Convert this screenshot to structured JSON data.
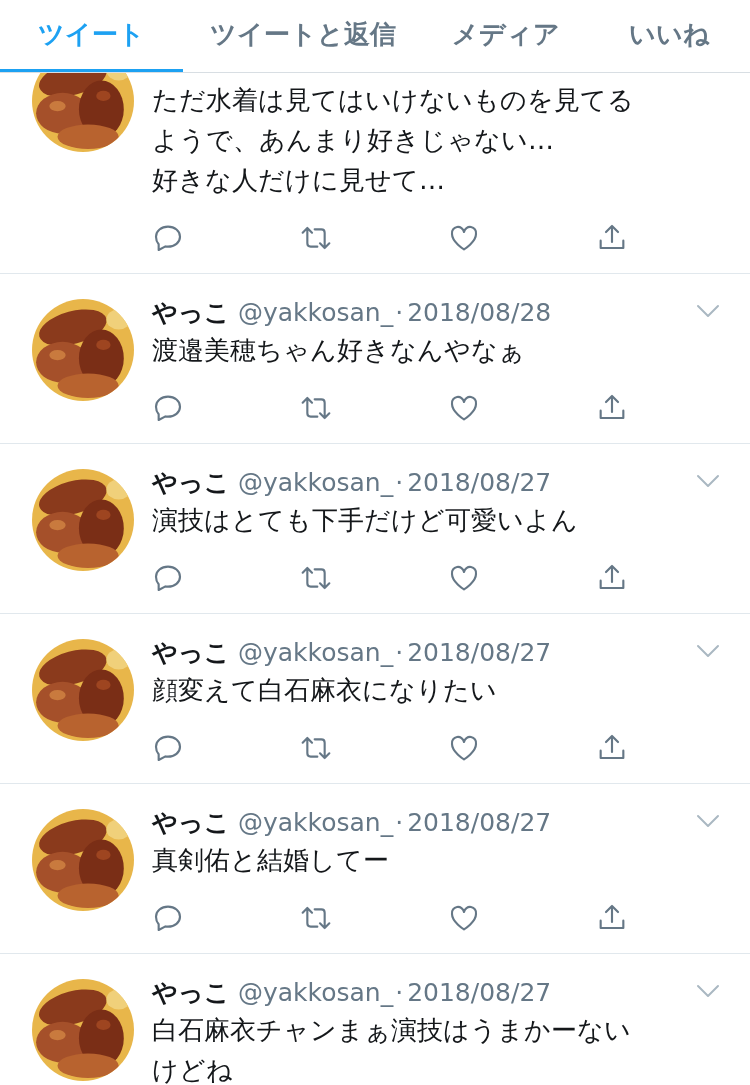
{
  "tabs": [
    {
      "label": "ツイート",
      "selected": true
    },
    {
      "label": "ツイートと返信",
      "selected": false
    },
    {
      "label": "メディア",
      "selected": false
    },
    {
      "label": "いいね",
      "selected": false
    }
  ],
  "tweets": [
    {
      "kind": "partial",
      "text": "ただ水着は見てはいけないものを見てるようで、あんまり好きじゃない…\n好きな人だけに見せて…"
    },
    {
      "kind": "full",
      "name": "やっこ",
      "handle": "@yakkosan_",
      "dot": "·",
      "date": "2018/08/28",
      "text": "渡邉美穂ちゃん好きなんやなぁ"
    },
    {
      "kind": "full",
      "name": "やっこ",
      "handle": "@yakkosan_",
      "dot": "·",
      "date": "2018/08/27",
      "text": "演技はとても下手だけど可愛いよん"
    },
    {
      "kind": "full",
      "name": "やっこ",
      "handle": "@yakkosan_",
      "dot": "·",
      "date": "2018/08/27",
      "text": "顔変えて白石麻衣になりたい"
    },
    {
      "kind": "full",
      "name": "やっこ",
      "handle": "@yakkosan_",
      "dot": "·",
      "date": "2018/08/27",
      "text": "真剣佑と結婚してー"
    },
    {
      "kind": "full",
      "name": "やっこ",
      "handle": "@yakkosan_",
      "dot": "·",
      "date": "2018/08/27",
      "text": "白石麻衣チャンまぁ演技はうまかーないけどね"
    }
  ]
}
